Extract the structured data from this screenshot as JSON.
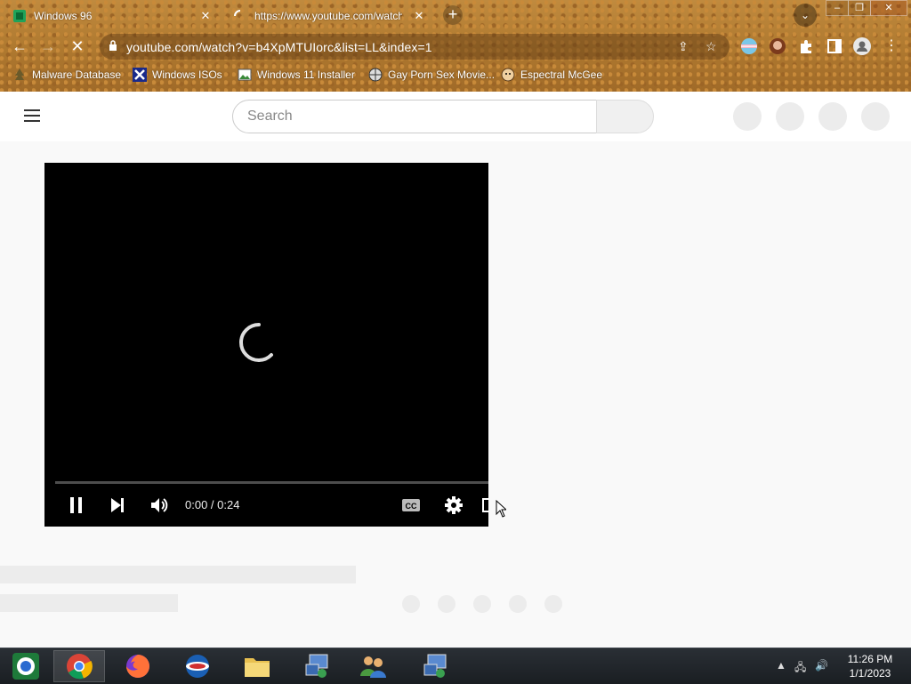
{
  "browser": {
    "tabs": [
      {
        "title": "Windows 96",
        "active": true
      },
      {
        "title": "https://www.youtube.com/watch",
        "active": false
      }
    ],
    "new_tab_label": "+",
    "url": "youtube.com/watch?v=b4XpMTUIorc&list=LL&index=1",
    "bookmarks": [
      {
        "label": "Malware Database",
        "icon": "tree-icon"
      },
      {
        "label": "Windows ISOs",
        "icon": "x-icon"
      },
      {
        "label": "Windows 11 Installer",
        "icon": "image-icon"
      },
      {
        "label": "Gay Porn Sex Movie...",
        "icon": "globe-icon"
      },
      {
        "label": "Espectral McGee",
        "icon": "face-icon"
      }
    ],
    "window_buttons": [
      "–",
      "❐",
      "✕"
    ]
  },
  "youtube": {
    "search_placeholder": "Search",
    "player": {
      "time": "0:00 / 0:24",
      "state": "loading",
      "progress": 0
    }
  },
  "taskbar": {
    "apps": [
      {
        "name": "start-orb",
        "active": false
      },
      {
        "name": "chrome",
        "active": true
      },
      {
        "name": "firefox",
        "active": false
      },
      {
        "name": "outlook",
        "active": false
      },
      {
        "name": "file-explorer",
        "active": false
      },
      {
        "name": "network-setup",
        "active": false
      },
      {
        "name": "users",
        "active": false
      },
      {
        "name": "network-setup-2",
        "active": false
      }
    ],
    "clock_time": "11:26 PM",
    "clock_date": "1/1/2023"
  },
  "colors": {
    "theme_brown": "#b07a30",
    "player_bg": "#000000",
    "page_bg": "#f9f9f9"
  }
}
